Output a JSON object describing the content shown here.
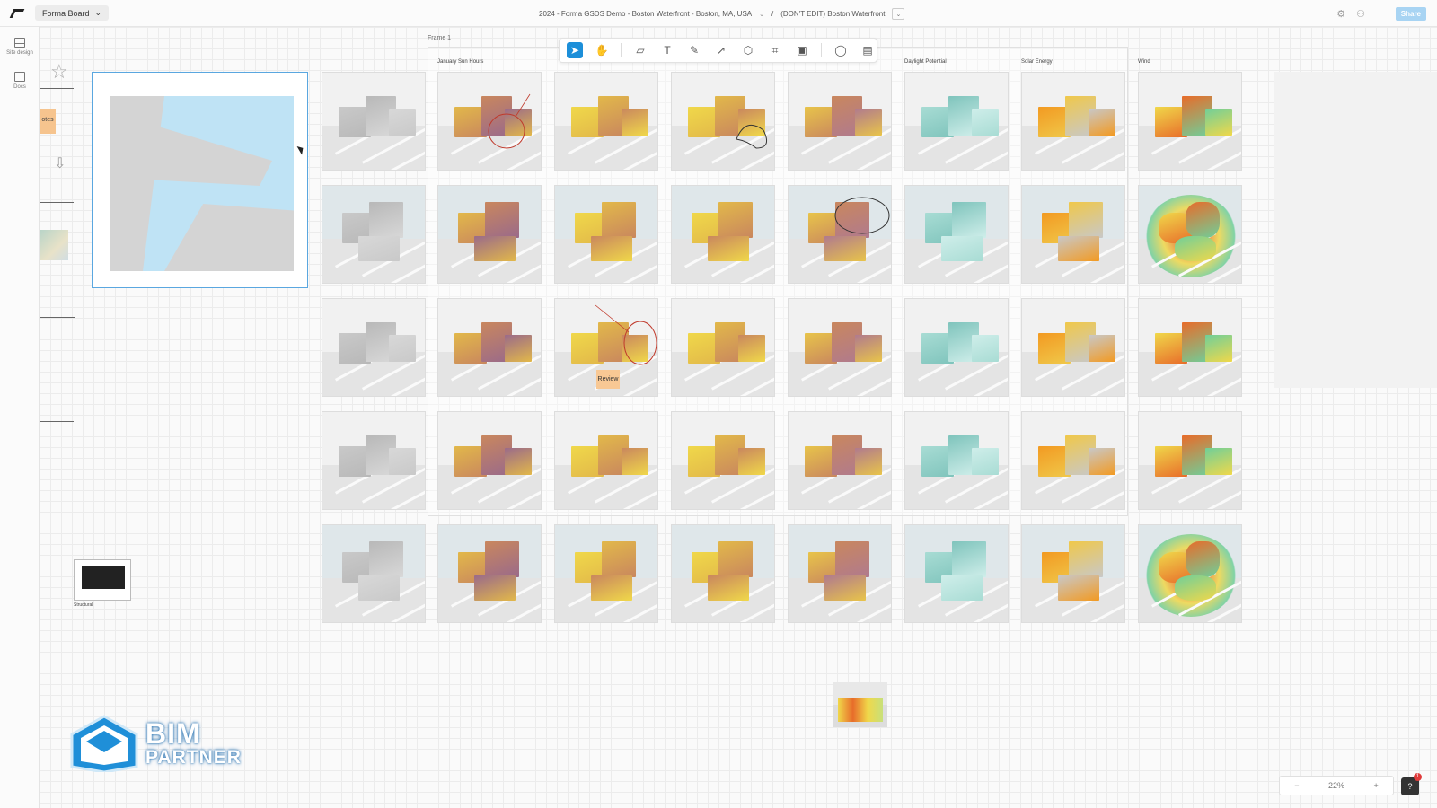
{
  "app": {
    "name": "Forma Board"
  },
  "header": {
    "project": "2024 - Forma GSDS Demo - Boston Waterfront - Boston, MA, USA",
    "separator": "/",
    "board": "(DON'T EDIT) Boston Waterfront",
    "share_label": "Share"
  },
  "rail": {
    "items": [
      {
        "label": "Site design",
        "icon": "site-design-icon"
      },
      {
        "label": "Docs",
        "icon": "docs-icon"
      }
    ]
  },
  "frame": {
    "label": "Frame 1"
  },
  "columns": [
    "January Sun Hours",
    "",
    "",
    "",
    "Daylight Potential",
    "Solar Energy",
    "Wind"
  ],
  "left": {
    "note_text": "otes",
    "doc_caption": "Structural"
  },
  "review_note": "Review",
  "zoom": {
    "minus": "−",
    "value": "22%",
    "plus": "+"
  },
  "help": {
    "badge": "1"
  },
  "brand": {
    "line1": "BIM",
    "line2": "PARTNER"
  },
  "colors": {
    "accent": "#1c8fd9",
    "share": "#a8d4f3",
    "sun": "#f0d84a",
    "daylight": "#a8dcd4",
    "solar": "#f29a22"
  }
}
